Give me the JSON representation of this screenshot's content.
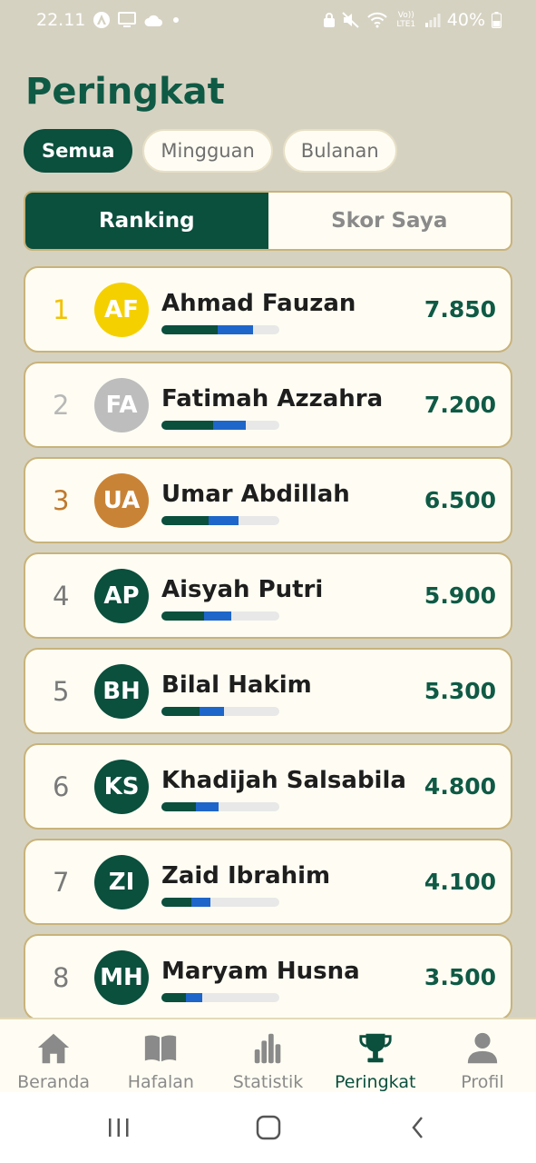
{
  "status_bar": {
    "time": "22.11",
    "battery": "40%",
    "network": "Vo)) LTE1"
  },
  "page": {
    "title": "Peringkat"
  },
  "filters": {
    "chips": [
      "Semua",
      "Mingguan",
      "Bulanan"
    ],
    "selected": "Semua"
  },
  "segmented": {
    "ranking_label": "Ranking",
    "myscore_label": "Skor Saya",
    "selected": "Ranking"
  },
  "leaderboard": [
    {
      "rank": "1",
      "initials": "AF",
      "name": "Ahmad Fauzan",
      "score": "7.850",
      "progress_green": 0.48,
      "progress_blue": 0.3,
      "avatar_color": "#f5d000",
      "rank_color": "#f2c200"
    },
    {
      "rank": "2",
      "initials": "FA",
      "name": "Fatimah Azzahra",
      "score": "7.200",
      "progress_green": 0.44,
      "progress_blue": 0.28,
      "avatar_color": "#bdbdbd",
      "rank_color": "#b8b8b8"
    },
    {
      "rank": "3",
      "initials": "UA",
      "name": "Umar Abdillah",
      "score": "6.500",
      "progress_green": 0.4,
      "progress_blue": 0.25,
      "avatar_color": "#c98337",
      "rank_color": "#c07a2f"
    },
    {
      "rank": "4",
      "initials": "AP",
      "name": "Aisyah Putri",
      "score": "5.900",
      "progress_green": 0.36,
      "progress_blue": 0.23,
      "avatar_color": "#0b4f3d",
      "rank_color": "#7a7a7a"
    },
    {
      "rank": "5",
      "initials": "BH",
      "name": "Bilal Hakim",
      "score": "5.300",
      "progress_green": 0.32,
      "progress_blue": 0.21,
      "avatar_color": "#0b4f3d",
      "rank_color": "#7a7a7a"
    },
    {
      "rank": "6",
      "initials": "KS",
      "name": "Khadijah Salsabila",
      "score": "4.800",
      "progress_green": 0.29,
      "progress_blue": 0.19,
      "avatar_color": "#0b4f3d",
      "rank_color": "#7a7a7a"
    },
    {
      "rank": "7",
      "initials": "ZI",
      "name": "Zaid Ibrahim",
      "score": "4.100",
      "progress_green": 0.25,
      "progress_blue": 0.16,
      "avatar_color": "#0b4f3d",
      "rank_color": "#7a7a7a"
    },
    {
      "rank": "8",
      "initials": "MH",
      "name": "Maryam Husna",
      "score": "3.500",
      "progress_green": 0.21,
      "progress_blue": 0.14,
      "avatar_color": "#0b4f3d",
      "rank_color": "#7a7a7a"
    }
  ],
  "bottom_nav": {
    "items": [
      {
        "label": "Beranda",
        "icon": "home-icon"
      },
      {
        "label": "Hafalan",
        "icon": "book-icon"
      },
      {
        "label": "Statistik",
        "icon": "bar-chart-icon"
      },
      {
        "label": "Peringkat",
        "icon": "trophy-icon"
      },
      {
        "label": "Profil",
        "icon": "person-icon"
      }
    ],
    "active": "Peringkat"
  },
  "colors": {
    "primary": "#0b4f3d",
    "accent_blue": "#1e66c9",
    "background": "#d6d2c2",
    "card": "#fffdf3",
    "card_border": "#c8b37a"
  }
}
